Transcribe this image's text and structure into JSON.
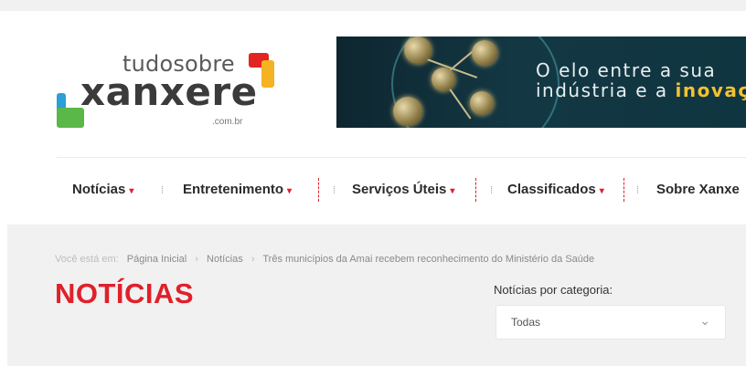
{
  "logo": {
    "line1": "tudosobre",
    "line2": "xanxere",
    "line3": ".com.br"
  },
  "banner": {
    "line1": "O elo entre a sua",
    "line2_start": "indústria e a ",
    "line2_bold": "inovaç"
  },
  "nav": {
    "items": [
      {
        "label": "Notícias"
      },
      {
        "label": "Entretenimento"
      },
      {
        "label": "Serviços Úteis"
      },
      {
        "label": "Classificados"
      },
      {
        "label": "Sobre Xanxe"
      }
    ],
    "caret": "▾",
    "separator": "⁞"
  },
  "breadcrumb": {
    "prefix": "Você está em:",
    "items": [
      "Página Inicial",
      "Notícias",
      "Três municípios da Amai recebem reconhecimento do Ministério da Saúde"
    ],
    "separator": "›"
  },
  "page": {
    "title": "NOTÍCIAS"
  },
  "category": {
    "label": "Notícias por categoria:",
    "selected": "Todas",
    "chevron": "⌄"
  },
  "colors": {
    "accent": "#e0202a",
    "banner_highlight": "#f2c230"
  }
}
